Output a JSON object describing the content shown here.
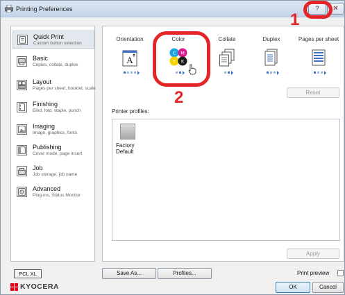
{
  "window": {
    "title": "Printing Preferences",
    "help_label": "?",
    "close_label": "✕"
  },
  "annotations": {
    "step1": "1",
    "step2": "2",
    "accent": "#e42528"
  },
  "sidebar": {
    "items": [
      {
        "title": "Quick Print",
        "subtitle": "Custom button selection",
        "icon": "quick-print-icon"
      },
      {
        "title": "Basic",
        "subtitle": "Copies, collate, duplex",
        "icon": "basic-icon"
      },
      {
        "title": "Layout",
        "subtitle": "Pages per sheet, booklet, scale",
        "icon": "layout-icon"
      },
      {
        "title": "Finishing",
        "subtitle": "Bind, fold, staple, punch",
        "icon": "finishing-icon"
      },
      {
        "title": "Imaging",
        "subtitle": "Image, graphics, fonts",
        "icon": "imaging-icon"
      },
      {
        "title": "Publishing",
        "subtitle": "Cover mode, page insert",
        "icon": "publishing-icon"
      },
      {
        "title": "Job",
        "subtitle": "Job storage, job name",
        "icon": "job-icon"
      },
      {
        "title": "Advanced",
        "subtitle": "Plug-ins, Status Monitor",
        "icon": "advanced-icon"
      }
    ]
  },
  "features": [
    {
      "label": "Orientation",
      "icon": "orientation-icon"
    },
    {
      "label": "Color",
      "icon": "color-icon"
    },
    {
      "label": "Collate",
      "icon": "collate-icon"
    },
    {
      "label": "Duplex",
      "icon": "duplex-icon"
    },
    {
      "label": "Pages per sheet",
      "icon": "pages-per-sheet-icon"
    }
  ],
  "color_letters": {
    "c": "C",
    "m": "M",
    "y": "Y",
    "k": "K"
  },
  "orientation_letter": "A",
  "buttons": {
    "reset": "Reset",
    "apply": "Apply",
    "save_as": "Save As...",
    "profiles": "Profiles...",
    "ok": "OK",
    "cancel": "Cancel"
  },
  "profiles": {
    "label": "Printer profiles:",
    "items": [
      {
        "line1": "Factory",
        "line2": "Default"
      }
    ]
  },
  "footer": {
    "pdl": "PCL XL",
    "print_preview": "Print preview",
    "print_preview_checked": false,
    "brand": "KYOCERA"
  }
}
